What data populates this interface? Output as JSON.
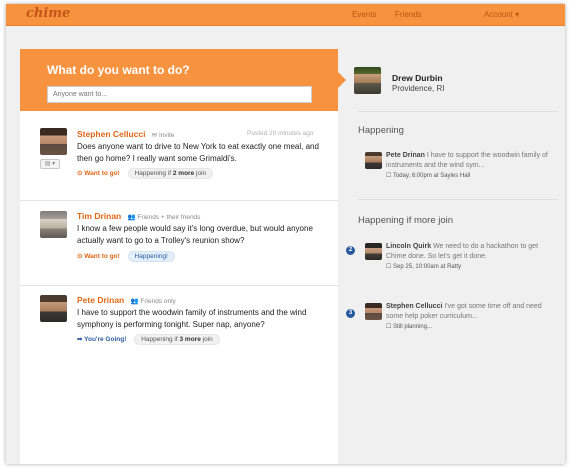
{
  "topbar": {
    "logo": "chime",
    "nav": {
      "events": "Events",
      "friends": "Friends",
      "account": "Account ▾"
    }
  },
  "prompt": {
    "title": "What do you want to do?",
    "input_placeholder": "Anyone want to..."
  },
  "posts": [
    {
      "author": "Stephen Cellucci",
      "visibility": "✉ Invite",
      "timestamp": "Posted 20 minutes ago",
      "text": "Does anyone want to drive to New York to eat exactly one meal, and then go home? I really want some Grimaldi's.",
      "action": "⊙ Want to go!",
      "pill_prefix": "Happening if ",
      "pill_bold": "2 more",
      "pill_suffix": " join",
      "avatar_toggle": "▤ ▾"
    },
    {
      "author": "Tim Drinan",
      "visibility": "👥 Friends + their friends",
      "text": "I know a few people would say it's long overdue, but would anyone actually want to go to a Trolley's reunion show?",
      "action": "⊙ Want to go!",
      "pill": "Happening!"
    },
    {
      "author": "Pete Drinan",
      "visibility": "👥 Friends only",
      "text": "I have to support the woodwin family of instruments and the wind symphony is performing tonight. Super nap, anyone?",
      "action": "➡ You're Going!",
      "pill_prefix": "Happening if ",
      "pill_bold": "3 more",
      "pill_suffix": " join"
    }
  ],
  "profile": {
    "name": "Drew Durbin",
    "location": "Providence, RI"
  },
  "sidebar": {
    "happening_title": "Happening",
    "happening": [
      {
        "name": "Pete Drinan",
        "text": " I have to support the woodwin family of instruments and the wind sym...",
        "meta": "☐ Today, 6:00pm at Sayles Hall"
      }
    ],
    "more_title": "Happening if more join",
    "more": [
      {
        "badge": "2",
        "name": "Lincoln Quirk",
        "text": " We need to do a hackathon to get Chime done. So let's get it done.",
        "meta": "☐ Sep 25, 10:00am at Ratty"
      },
      {
        "badge": "3",
        "name": "Stephen Cellucci",
        "text": " I've got some time off and need some help poker curriculum...",
        "meta": "☐ Still planning..."
      }
    ]
  },
  "colors": {
    "accent": "#f7933f",
    "link": "#e06617",
    "blue": "#2a5a9e"
  }
}
